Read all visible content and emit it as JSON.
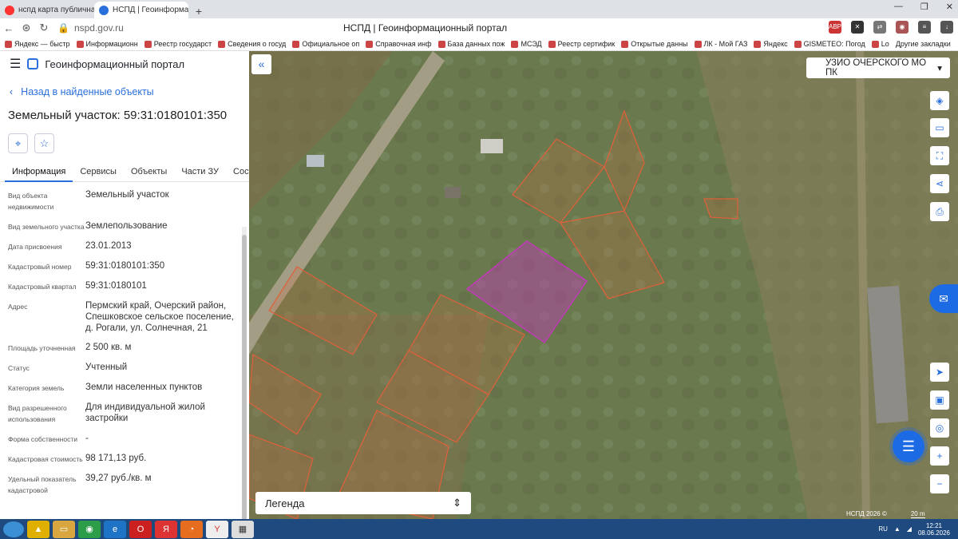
{
  "browser": {
    "tabs": [
      {
        "title": "нспд карта публичная кад"
      },
      {
        "title": "НСПД | Геоинформацио"
      }
    ],
    "url": "nspd.gov.ru",
    "page_title": "НСПД | Геоинформационный портал",
    "bookmarks": [
      "Яндекс — быстр",
      "Информационн",
      "Реестр государст",
      "Сведения о госуд",
      "Официальное оп",
      "Справочная инф",
      "База данных пож",
      "МСЭД",
      "Реестр сертифик",
      "Открытые данны",
      "ЛК - Мой ГАЗ",
      "Яндекс",
      "GISMETEO: Погод",
      "Lo"
    ],
    "other_bookmarks": "Другие закладки"
  },
  "app": {
    "title": "Геоинформационный портал",
    "back_link": "Назад в найденные объекты",
    "object_title": "Земельный участок: 59:31:0180101:350",
    "info_tabs": [
      "Информация",
      "Сервисы",
      "Объекты",
      "Части ЗУ",
      "Состав"
    ],
    "properties": [
      {
        "label": "Вид объекта недвижимости",
        "value": "Земельный участок"
      },
      {
        "label": "Вид земельного участка",
        "value": "Землепользование"
      },
      {
        "label": "Дата присвоения",
        "value": "23.01.2013"
      },
      {
        "label": "Кадастровый номер",
        "value": "59:31:0180101:350"
      },
      {
        "label": "Кадастровый квартал",
        "value": "59:31:0180101"
      },
      {
        "label": "Адрес",
        "value": "Пермский край, Очерский район, Спешковское сельское поселение, д. Рогали, ул. Солнечная, 21"
      },
      {
        "label": "Площадь уточненная",
        "value": "2 500 кв. м"
      },
      {
        "label": "Статус",
        "value": "Учтенный"
      },
      {
        "label": "Категория земель",
        "value": "Земли населенных пунктов"
      },
      {
        "label": "Вид разрешенного использования",
        "value": "Для индивидуальной жилой застройки"
      },
      {
        "label": "Форма собственности",
        "value": "-"
      },
      {
        "label": "Кадастровая стоимость",
        "value": "98 171,13 руб."
      },
      {
        "label": "Удельный показатель кадастровой",
        "value": "39,27 руб./кв. м"
      }
    ]
  },
  "map": {
    "layer_select": "УЗИО ОЧЕРСКОГО МО ПК",
    "legend_label": "Легенда",
    "attribution": "НСПД 2026 ©",
    "scale": "20 m",
    "selected_color": "#c03ab8",
    "parcel_color": "#e0603a"
  },
  "taskbar": {
    "lang": "RU",
    "time": "12:21",
    "date": "08.06.2026"
  }
}
